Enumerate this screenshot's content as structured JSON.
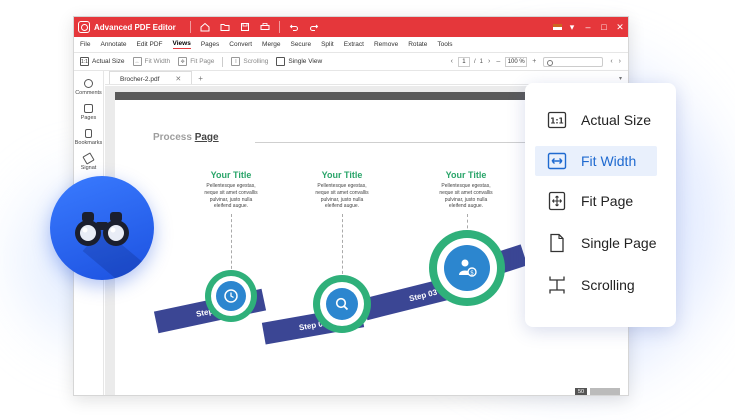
{
  "app": {
    "title": "Advanced PDF Editor",
    "accent_color": "#e5373b",
    "titlebar_icons": [
      "home-icon",
      "folder-icon",
      "save-icon",
      "print-icon",
      "undo-icon",
      "redo-icon"
    ],
    "window_controls": [
      "minimize-icon",
      "maximize-icon",
      "close-icon"
    ]
  },
  "menu": [
    "File",
    "Annotate",
    "Edit PDF",
    "Views",
    "Pages",
    "Convert",
    "Merge",
    "Secure",
    "Split",
    "Extract",
    "Remove",
    "Rotate",
    "Tools"
  ],
  "menu_active": "Views",
  "toolbar": {
    "tools": [
      "Actual Size",
      "Fit Width",
      "Fit Page",
      "Scrolling",
      "Single View"
    ],
    "page_current": "1",
    "page_total": "1",
    "zoom": "100 %"
  },
  "sidebar": [
    "Comments",
    "Pages",
    "Bookmarks",
    "Signat"
  ],
  "document": {
    "tab_name": "Brocher-2.pdf",
    "heading_prefix": "Process",
    "heading_bold": "Page",
    "page_number": "50",
    "columns": [
      {
        "title": "Your Title",
        "lines": [
          "Pellentesque egestas,",
          "neque sit amet convallis",
          "pulvinar, justo nulla",
          "eleifend augue."
        ]
      },
      {
        "title": "Your Title",
        "lines": [
          "Pellentesque egestas,",
          "neque sit amet convallis",
          "pulvinar, justo nulla",
          "eleifend augue."
        ]
      },
      {
        "title": "Your Title",
        "lines": [
          "Pellentesque egestas,",
          "neque sit amet convallis",
          "pulvinar, justo nulla",
          "eleifend augue."
        ]
      }
    ],
    "steps": [
      "Step 01",
      "Step 02",
      "Step 03"
    ],
    "colors": {
      "green": "#2fb07a",
      "navy": "#3b4694",
      "blue": "#2c86cf",
      "title_green": "#2aa56a"
    }
  },
  "view_menu": {
    "items": [
      {
        "label": "Actual Size",
        "icon": "actual-size-icon"
      },
      {
        "label": "Fit Width",
        "icon": "fit-width-icon"
      },
      {
        "label": "Fit Page",
        "icon": "fit-page-icon"
      },
      {
        "label": "Single Page",
        "icon": "single-page-icon"
      },
      {
        "label": "Scrolling",
        "icon": "scrolling-icon"
      }
    ],
    "active": "Fit Width",
    "active_color": "#1f6ad0"
  },
  "badge": {
    "icon": "binoculars-icon",
    "color": "#2a66f0"
  }
}
